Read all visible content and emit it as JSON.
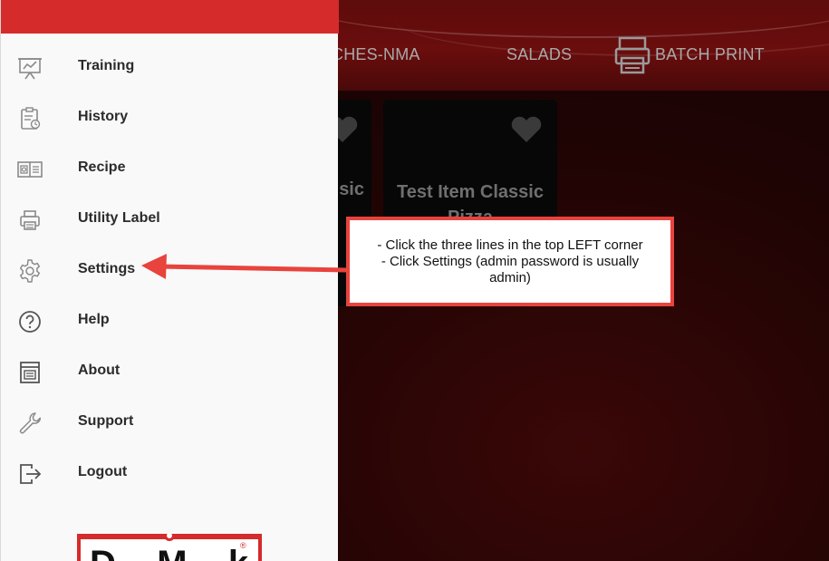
{
  "background_app": {
    "tabs": [
      {
        "label": "CHES-NMA"
      },
      {
        "label": "SALADS"
      },
      {
        "label": "BATCH PRINT"
      }
    ],
    "cards": [
      {
        "title": "sic"
      },
      {
        "title": "Test Item Classic Pizza"
      }
    ]
  },
  "drawer": {
    "accent_color": "#d52b2b",
    "menu": [
      {
        "label": "Training",
        "icon": "presentation-chart-icon"
      },
      {
        "label": "History",
        "icon": "clipboard-history-icon"
      },
      {
        "label": "Recipe",
        "icon": "recipe-book-icon"
      },
      {
        "label": "Utility Label",
        "icon": "printer-icon"
      },
      {
        "label": "Settings",
        "icon": "gear-icon"
      },
      {
        "label": "Help",
        "icon": "help-circle-icon"
      },
      {
        "label": "About",
        "icon": "about-document-icon"
      },
      {
        "label": "Support",
        "icon": "wrench-icon"
      },
      {
        "label": "Logout",
        "icon": "logout-icon"
      }
    ],
    "logo": {
      "text": "DateMark",
      "icon": "brand-logo"
    }
  },
  "annotation": {
    "border_color": "#e8433c",
    "lines": [
      "- Click the three lines in the top LEFT corner",
      "- Click Settings (admin password is usually admin)"
    ]
  }
}
